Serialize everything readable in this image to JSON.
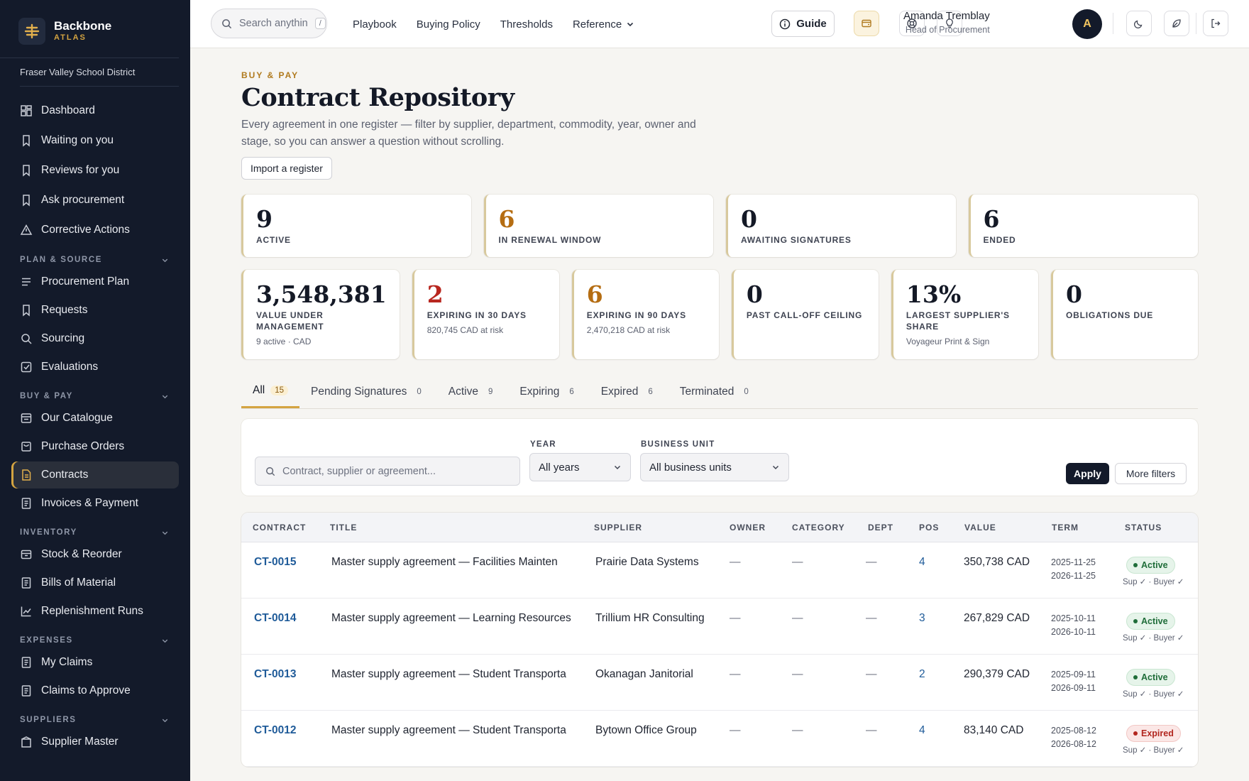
{
  "brand": {
    "name": "Backbone",
    "sub": "ATLAS"
  },
  "org": "Fraser Valley School District",
  "sidebar": {
    "top": [
      {
        "label": "Dashboard",
        "icon": "dashboard-icon"
      },
      {
        "label": "Waiting on you",
        "icon": "bookmark-icon"
      },
      {
        "label": "Reviews for you",
        "icon": "bookmark-icon"
      },
      {
        "label": "Ask procurement",
        "icon": "bookmark-icon"
      },
      {
        "label": "Corrective Actions",
        "icon": "warning-icon"
      }
    ],
    "sections": [
      {
        "title": "PLAN & SOURCE",
        "items": [
          {
            "label": "Procurement Plan",
            "icon": "list-icon"
          },
          {
            "label": "Requests",
            "icon": "bookmark-icon"
          },
          {
            "label": "Sourcing",
            "icon": "search-icon"
          },
          {
            "label": "Evaluations",
            "icon": "checkbox-icon"
          }
        ]
      },
      {
        "title": "BUY & PAY",
        "items": [
          {
            "label": "Our Catalogue",
            "icon": "catalogue-icon"
          },
          {
            "label": "Purchase Orders",
            "icon": "cart-icon"
          },
          {
            "label": "Contracts",
            "icon": "contract-icon",
            "active": true
          },
          {
            "label": "Invoices & Payment",
            "icon": "invoice-icon"
          }
        ]
      },
      {
        "title": "INVENTORY",
        "items": [
          {
            "label": "Stock & Reorder",
            "icon": "box-icon"
          },
          {
            "label": "Bills of Material",
            "icon": "invoice-icon"
          },
          {
            "label": "Replenishment Runs",
            "icon": "chart-icon"
          }
        ]
      },
      {
        "title": "EXPENSES",
        "items": [
          {
            "label": "My Claims",
            "icon": "invoice-icon"
          },
          {
            "label": "Claims to Approve",
            "icon": "invoice-icon"
          }
        ]
      },
      {
        "title": "SUPPLIERS",
        "items": [
          {
            "label": "Supplier Master",
            "icon": "supplier-icon"
          }
        ]
      }
    ]
  },
  "topbar": {
    "search_placeholder": "Search anythin",
    "search_kbd": "/",
    "links": [
      "Playbook",
      "Buying Policy",
      "Thresholds",
      "Reference"
    ],
    "guide_label": "Guide",
    "user_name": "Amanda Tremblay",
    "user_role": "Head of Procurement",
    "avatar_initial": "A"
  },
  "page": {
    "eyebrow": "BUY & PAY",
    "title": "Contract Repository",
    "lede": "Every agreement in one register — filter by supplier, department, commodity, year, owner and stage, so you can answer a question without scrolling.",
    "import_label": "Import a register"
  },
  "kpis_row1": [
    {
      "value": "9",
      "label": "ACTIVE",
      "tone": "dark"
    },
    {
      "value": "6",
      "label": "IN RENEWAL WINDOW",
      "tone": "amber"
    },
    {
      "value": "0",
      "label": "AWAITING SIGNATURES",
      "tone": "dark"
    },
    {
      "value": "6",
      "label": "ENDED",
      "tone": "dark"
    }
  ],
  "kpis_row2": [
    {
      "value": "3,548,381",
      "label": "VALUE UNDER MANAGEMENT",
      "note": "9 active · CAD",
      "tone": "dark"
    },
    {
      "value": "2",
      "label": "EXPIRING IN 30 DAYS",
      "note": "820,745 CAD at risk",
      "tone": "red"
    },
    {
      "value": "6",
      "label": "EXPIRING IN 90 DAYS",
      "note": "2,470,218 CAD at risk",
      "tone": "amber"
    },
    {
      "value": "0",
      "label": "PAST CALL-OFF CEILING",
      "note": "",
      "tone": "dark"
    },
    {
      "value": "13%",
      "label": "LARGEST SUPPLIER'S SHARE",
      "note": "Voyageur Print & Sign",
      "tone": "dark"
    },
    {
      "value": "0",
      "label": "OBLIGATIONS DUE",
      "note": "",
      "tone": "dark"
    }
  ],
  "tabs": [
    {
      "label": "All",
      "count": "15",
      "active": true
    },
    {
      "label": "Pending Signatures",
      "count": "0"
    },
    {
      "label": "Active",
      "count": "9"
    },
    {
      "label": "Expiring",
      "count": "6"
    },
    {
      "label": "Expired",
      "count": "6"
    },
    {
      "label": "Terminated",
      "count": "0"
    }
  ],
  "filters": {
    "search_placeholder": "Contract, supplier or agreement...",
    "year_label": "YEAR",
    "year_value": "All years",
    "unit_label": "BUSINESS UNIT",
    "unit_value": "All business units",
    "apply_label": "Apply",
    "more_label": "More filters"
  },
  "table": {
    "headers": [
      "CONTRACT",
      "TITLE",
      "SUPPLIER",
      "OWNER",
      "CATEGORY",
      "DEPT",
      "POS",
      "VALUE",
      "TERM",
      "STATUS"
    ],
    "rows": [
      {
        "id": "CT-0015",
        "title": "Master supply agreement — Facilities Mainten",
        "supplier": "Prairie Data Systems",
        "owner": "—",
        "category": "—",
        "dept": "—",
        "pos": "4",
        "value": "350,738 CAD",
        "start": "2025-11-25",
        "end": "2026-11-25",
        "status": "Active",
        "sign": "Sup ✓ · Buyer ✓"
      },
      {
        "id": "CT-0014",
        "title": "Master supply agreement — Learning Resources",
        "supplier": "Trillium HR Consulting",
        "owner": "—",
        "category": "—",
        "dept": "—",
        "pos": "3",
        "value": "267,829 CAD",
        "start": "2025-10-11",
        "end": "2026-10-11",
        "status": "Active",
        "sign": "Sup ✓ · Buyer ✓"
      },
      {
        "id": "CT-0013",
        "title": "Master supply agreement — Student Transporta",
        "supplier": "Okanagan Janitorial",
        "owner": "—",
        "category": "—",
        "dept": "—",
        "pos": "2",
        "value": "290,379 CAD",
        "start": "2025-09-11",
        "end": "2026-09-11",
        "status": "Active",
        "sign": "Sup ✓ · Buyer ✓"
      },
      {
        "id": "CT-0012",
        "title": "Master supply agreement — Student Transporta",
        "supplier": "Bytown Office Group",
        "owner": "—",
        "category": "—",
        "dept": "—",
        "pos": "4",
        "value": "83,140 CAD",
        "start": "2025-08-12",
        "end": "2026-08-12",
        "status": "Expired",
        "sign": "Sup ✓ · Buyer ✓"
      }
    ]
  },
  "colors": {
    "sidebar": "#131a2a",
    "accent": "#d4a441",
    "amber": "#b56d12",
    "red": "#b8261f",
    "link": "#1f5b99"
  }
}
